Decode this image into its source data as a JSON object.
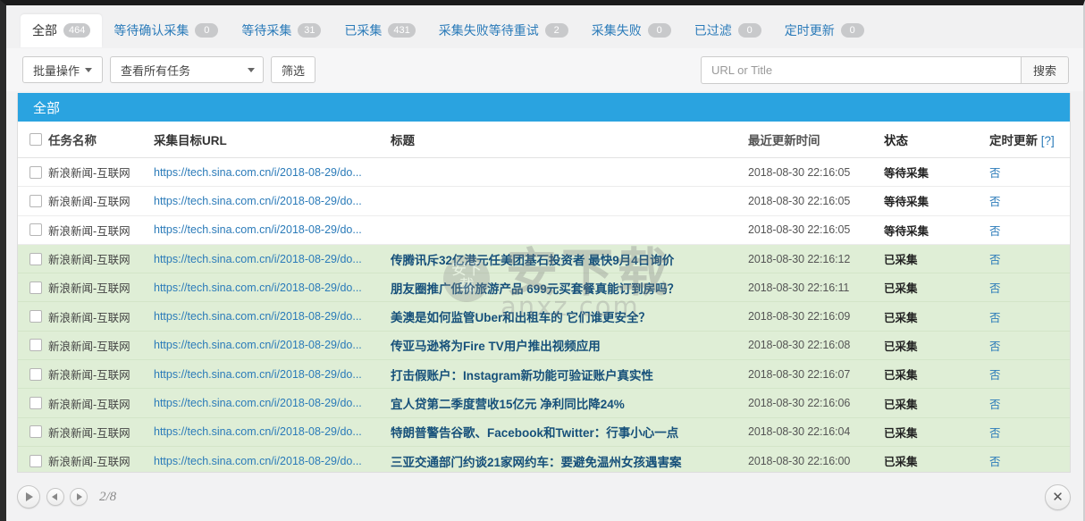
{
  "tabs": [
    {
      "label": "全部",
      "count": "464",
      "active": true
    },
    {
      "label": "等待确认采集",
      "count": "0",
      "active": false
    },
    {
      "label": "等待采集",
      "count": "31",
      "active": false
    },
    {
      "label": "已采集",
      "count": "431",
      "active": false
    },
    {
      "label": "采集失败等待重试",
      "count": "2",
      "active": false
    },
    {
      "label": "采集失败",
      "count": "0",
      "active": false
    },
    {
      "label": "已过滤",
      "count": "0",
      "active": false
    },
    {
      "label": "定时更新",
      "count": "0",
      "active": false
    }
  ],
  "toolbar": {
    "batch_label": "批量操作",
    "view_select_value": "查看所有任务",
    "filter_label": "筛选",
    "search_placeholder": "URL or Title",
    "search_value": "",
    "search_button_label": "搜索"
  },
  "panel": {
    "header_title": "全部",
    "columns": {
      "task_name": "任务名称",
      "target_url": "采集目标URL",
      "title": "标题",
      "last_update": "最近更新时间",
      "status": "状态",
      "scheduled_update": "定时更新",
      "scheduled_update_hint": "[?]"
    }
  },
  "rows": [
    {
      "task_name": "新浪新闻-互联网",
      "url": "https://tech.sina.com.cn/i/2018-08-29/do...",
      "title": "",
      "last_update": "2018-08-30 22:16:05",
      "status": "等待采集",
      "scheduled": "否",
      "state": "pending"
    },
    {
      "task_name": "新浪新闻-互联网",
      "url": "https://tech.sina.com.cn/i/2018-08-29/do...",
      "title": "",
      "last_update": "2018-08-30 22:16:05",
      "status": "等待采集",
      "scheduled": "否",
      "state": "pending"
    },
    {
      "task_name": "新浪新闻-互联网",
      "url": "https://tech.sina.com.cn/i/2018-08-29/do...",
      "title": "",
      "last_update": "2018-08-30 22:16:05",
      "status": "等待采集",
      "scheduled": "否",
      "state": "pending"
    },
    {
      "task_name": "新浪新闻-互联网",
      "url": "https://tech.sina.com.cn/i/2018-08-29/do...",
      "title": "传腾讯斥32亿港元任美团基石投资者 最快9月4日询价",
      "last_update": "2018-08-30 22:16:12",
      "status": "已采集",
      "scheduled": "否",
      "state": "done"
    },
    {
      "task_name": "新浪新闻-互联网",
      "url": "https://tech.sina.com.cn/i/2018-08-29/do...",
      "title": "朋友圈推广低价旅游产品 699元买套餐真能订到房吗？",
      "last_update": "2018-08-30 22:16:11",
      "status": "已采集",
      "scheduled": "否",
      "state": "done"
    },
    {
      "task_name": "新浪新闻-互联网",
      "url": "https://tech.sina.com.cn/i/2018-08-29/do...",
      "title": "美澳是如何监管Uber和出租车的 它们谁更安全？",
      "last_update": "2018-08-30 22:16:09",
      "status": "已采集",
      "scheduled": "否",
      "state": "done"
    },
    {
      "task_name": "新浪新闻-互联网",
      "url": "https://tech.sina.com.cn/i/2018-08-29/do...",
      "title": "传亚马逊将为Fire TV用户推出视频应用",
      "last_update": "2018-08-30 22:16:08",
      "status": "已采集",
      "scheduled": "否",
      "state": "done"
    },
    {
      "task_name": "新浪新闻-互联网",
      "url": "https://tech.sina.com.cn/i/2018-08-29/do...",
      "title": "打击假账户：Instagram新功能可验证账户真实性",
      "last_update": "2018-08-30 22:16:07",
      "status": "已采集",
      "scheduled": "否",
      "state": "done"
    },
    {
      "task_name": "新浪新闻-互联网",
      "url": "https://tech.sina.com.cn/i/2018-08-29/do...",
      "title": "宜人贷第二季度营收15亿元 净利同比降24%",
      "last_update": "2018-08-30 22:16:06",
      "status": "已采集",
      "scheduled": "否",
      "state": "done"
    },
    {
      "task_name": "新浪新闻-互联网",
      "url": "https://tech.sina.com.cn/i/2018-08-29/do...",
      "title": "特朗普警告谷歌、Facebook和Twitter：行事小心一点",
      "last_update": "2018-08-30 22:16:04",
      "status": "已采集",
      "scheduled": "否",
      "state": "done"
    },
    {
      "task_name": "新浪新闻-互联网",
      "url": "https://tech.sina.com.cn/i/2018-08-29/do...",
      "title": "三亚交通部门约谈21家网约车：要避免温州女孩遇害案",
      "last_update": "2018-08-30 22:16:00",
      "status": "已采集",
      "scheduled": "否",
      "state": "done"
    }
  ],
  "watermark": {
    "big_text": "安下载",
    "small_text": "anxz.com",
    "badge_text": "安下\n载"
  },
  "footer": {
    "page_indicator": "2/8",
    "play_icon": "play-icon",
    "prev_icon": "prev-icon",
    "next_icon": "next-icon",
    "close_icon": "close-icon"
  },
  "colors": {
    "accent": "#2aa3e0",
    "link": "#2b7bb9",
    "row_done_bg": "#dfeed6",
    "title_text": "#16507a"
  }
}
